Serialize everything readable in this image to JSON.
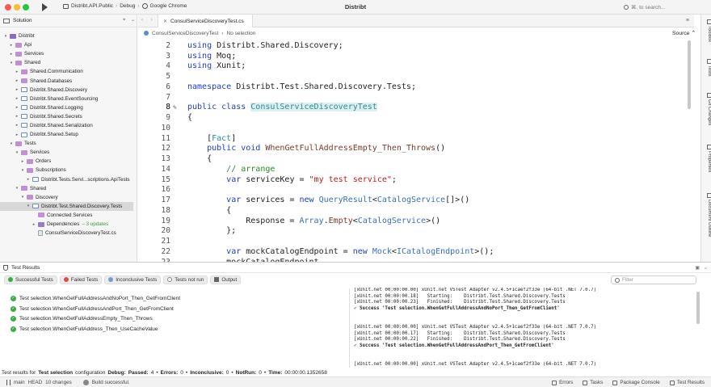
{
  "window": {
    "title": "Distribt",
    "config": {
      "project": "Distribt.API.Public",
      "configuration": "Debug",
      "device": "Google Chrome"
    },
    "search_placeholder": "⌘. to search..."
  },
  "solution": {
    "title": "Solution",
    "items": [
      {
        "label": "Distribt",
        "depth": 0,
        "type": "sol",
        "open": true
      },
      {
        "label": "Api",
        "depth": 1,
        "type": "folder",
        "open": false
      },
      {
        "label": "Services",
        "depth": 1,
        "type": "folder",
        "open": false
      },
      {
        "label": "Shared",
        "depth": 1,
        "type": "folder",
        "open": true
      },
      {
        "label": "Shared.Communication",
        "depth": 2,
        "type": "folder",
        "open": false
      },
      {
        "label": "Shared.Databases",
        "depth": 2,
        "type": "folder",
        "open": false
      },
      {
        "label": "Distribt.Shared.Discovery",
        "depth": 2,
        "type": "proj",
        "open": false
      },
      {
        "label": "Distribt.Shared.EventSourcing",
        "depth": 2,
        "type": "proj",
        "open": false
      },
      {
        "label": "Distribt.Shared.Logging",
        "depth": 2,
        "type": "proj",
        "open": false
      },
      {
        "label": "Distribt.Shared.Secrets",
        "depth": 2,
        "type": "proj",
        "open": false
      },
      {
        "label": "Distribt.Shared.Serialization",
        "depth": 2,
        "type": "proj",
        "open": false
      },
      {
        "label": "Distribt.Shared.Setup",
        "depth": 2,
        "type": "proj",
        "open": false
      },
      {
        "label": "Tests",
        "depth": 1,
        "type": "folder",
        "open": true
      },
      {
        "label": "Services",
        "depth": 2,
        "type": "folder",
        "open": true
      },
      {
        "label": "Orders",
        "depth": 3,
        "type": "folder",
        "open": false
      },
      {
        "label": "Subscriptions",
        "depth": 3,
        "type": "folder",
        "open": true
      },
      {
        "label": "Distribt.Tests.Servi...scriptions.ApiTests",
        "depth": 4,
        "type": "proj",
        "open": false
      },
      {
        "label": "Shared",
        "depth": 2,
        "type": "folder",
        "open": true
      },
      {
        "label": "Discovery",
        "depth": 3,
        "type": "folder",
        "open": true
      },
      {
        "label": "Distribt.Test.Shared.Discovery.Tests",
        "depth": 4,
        "type": "proj",
        "open": true,
        "selected": true
      },
      {
        "label": "Connected Services",
        "depth": 5,
        "type": "folder",
        "leaf": true
      },
      {
        "label": "Dependencies",
        "depth": 5,
        "type": "dep",
        "open": false,
        "suffix": "– 3 updates"
      },
      {
        "label": "ConsulServiceDiscoveryTest.cs",
        "depth": 5,
        "type": "file",
        "leaf": true
      }
    ]
  },
  "editor": {
    "tab_label": "ConsulServiceDiscoveryTest.cs",
    "breadcrumb": [
      "ConsulServiceDiscoveryTest",
      "No selection"
    ],
    "source_label": "Source ⌃",
    "current_line": "8",
    "lines": [
      {
        "n": "2",
        "html": "<span class=\"kw\">using</span> Distribt.Shared.Discovery;"
      },
      {
        "n": "3",
        "html": "<span class=\"kw\">using</span> Moq;"
      },
      {
        "n": "4",
        "html": "<span class=\"kw\">using</span> Xunit;"
      },
      {
        "n": "5",
        "html": ""
      },
      {
        "n": "6",
        "html": "<span class=\"kw\">namespace</span> Distribt.Test.Shared.Discovery.Tests;"
      },
      {
        "n": "7",
        "html": ""
      },
      {
        "n": "8",
        "html": "<span class=\"kw\">public class</span> <span class=\"tyh\">ConsulServiceDiscoveryTest</span>"
      },
      {
        "n": "9",
        "html": "{"
      },
      {
        "n": "10",
        "html": ""
      },
      {
        "n": "11",
        "html": "    [<span class=\"at\">Fact</span>]"
      },
      {
        "n": "12",
        "html": "    <span class=\"kw\">public void</span> <span class=\"mt\">WhenGetFullAddressEmpty_Then_Throws</span>()"
      },
      {
        "n": "13",
        "html": "    {"
      },
      {
        "n": "14",
        "html": "        <span class=\"cm\">// arrange</span>"
      },
      {
        "n": "15",
        "html": "        <span class=\"kw\">var</span> serviceKey = <span class=\"str\">\"my test service\"</span>;"
      },
      {
        "n": "16",
        "html": ""
      },
      {
        "n": "17",
        "html": "        <span class=\"kw\">var</span> services = <span class=\"kw\">new</span> <span class=\"ty\">QueryResult</span>&lt;<span class=\"ty\">CatalogService</span>[]&gt;()"
      },
      {
        "n": "18",
        "html": "        {"
      },
      {
        "n": "19",
        "html": "            Response = <span class=\"ty\">Array</span>.<span class=\"mt\">Empty</span>&lt;<span class=\"ty\">CatalogService</span>&gt;()"
      },
      {
        "n": "20",
        "html": "        };"
      },
      {
        "n": "21",
        "html": ""
      },
      {
        "n": "22",
        "html": "        <span class=\"kw\">var</span> mockCatalogEndpoint = <span class=\"kw\">new</span> <span class=\"ty\">Mock</span>&lt;<span class=\"ty\">ICatalogEndpoint</span>&gt;();"
      },
      {
        "n": "23",
        "html": "        mockCatalogEndpoint"
      }
    ]
  },
  "rail": [
    "Toolbox",
    "Tests",
    "Git Changes",
    "Properties",
    "Document Outline"
  ],
  "tests": {
    "title": "Test Results",
    "filters": {
      "successful": "Successful Tests",
      "failed": "Failed Tests",
      "inconclusive": "Inconclusive Tests",
      "not_run": "Tests not run",
      "output": "Output"
    },
    "filter_placeholder": "Filter",
    "results": [
      "Test selection.WhenGetFullAddressAndNoPort_Then_GetFromClient",
      "Test selection.WhenGetFullAddressAndPort_Then_GetFromClient",
      "Test selection.WhenGetFullAddressEmpty_Then_Throws",
      "Test selection.WhenGetFullAddress_Then_UseCacheValue"
    ],
    "console": [
      {
        "text": "[xUnit.net 00:00:00.00] xUnit.net VSTest Adapter v2.4.5+1caef2f33e (64-bit .NET 7.0.7)",
        "cls": ""
      },
      {
        "text": "[xUnit.net 00:00:00.18]   Starting:    Distribt.Test.Shared.Discovery.Tests",
        "cls": ""
      },
      {
        "text": "[xUnit.net 00:00:00.23]   Finished:    Distribt.Test.Shared.Discovery.Tests",
        "cls": ""
      },
      {
        "text": "✓ Success 'Test selection.WhenGetFullAddressAndNoPort_Then_GetFromClient'",
        "cls": "succ"
      },
      {
        "text": "",
        "cls": "gap"
      },
      {
        "text": "",
        "cls": "gap"
      },
      {
        "text": "[xUnit.net 00:00:00.00] xUnit.net VSTest Adapter v2.4.5+1caef2f33e (64-bit .NET 7.0.7)",
        "cls": ""
      },
      {
        "text": "[xUnit.net 00:00:00.17]   Starting:    Distribt.Test.Shared.Discovery.Tests",
        "cls": ""
      },
      {
        "text": "[xUnit.net 00:00:00.22]   Finished:    Distribt.Test.Shared.Discovery.Tests",
        "cls": ""
      },
      {
        "text": "✓ Success 'Test selection.WhenGetFullAddressAndPort_Then_GetFromClient'",
        "cls": "succ"
      },
      {
        "text": "",
        "cls": "gap"
      },
      {
        "text": "",
        "cls": "gap"
      },
      {
        "text": "[xUnit.net 00:00:00.00] xUnit.net VSTest Adapter v2.4.5+1caef2f33e (64-bit .NET 7.0.7)",
        "cls": ""
      }
    ],
    "summary": {
      "prefix": "Test results for",
      "selection": "Test selection",
      "config_label": "configuration",
      "config": "Debug:",
      "passed_label": "Passed:",
      "passed": "4",
      "errors_label": "Errors:",
      "errors": "0",
      "inconclusive_label": "Inconclusive:",
      "inconclusive": "0",
      "notrun_label": "NotRun:",
      "notrun": "0",
      "time_label": "Time:",
      "time": "00:00:00.1352658"
    }
  },
  "status": {
    "branch": "main",
    "head": "HEAD",
    "changes": "10 changes",
    "build": "Build successful.",
    "right": [
      "Errors",
      "Tasks",
      "Package Console",
      "Test Results"
    ]
  }
}
